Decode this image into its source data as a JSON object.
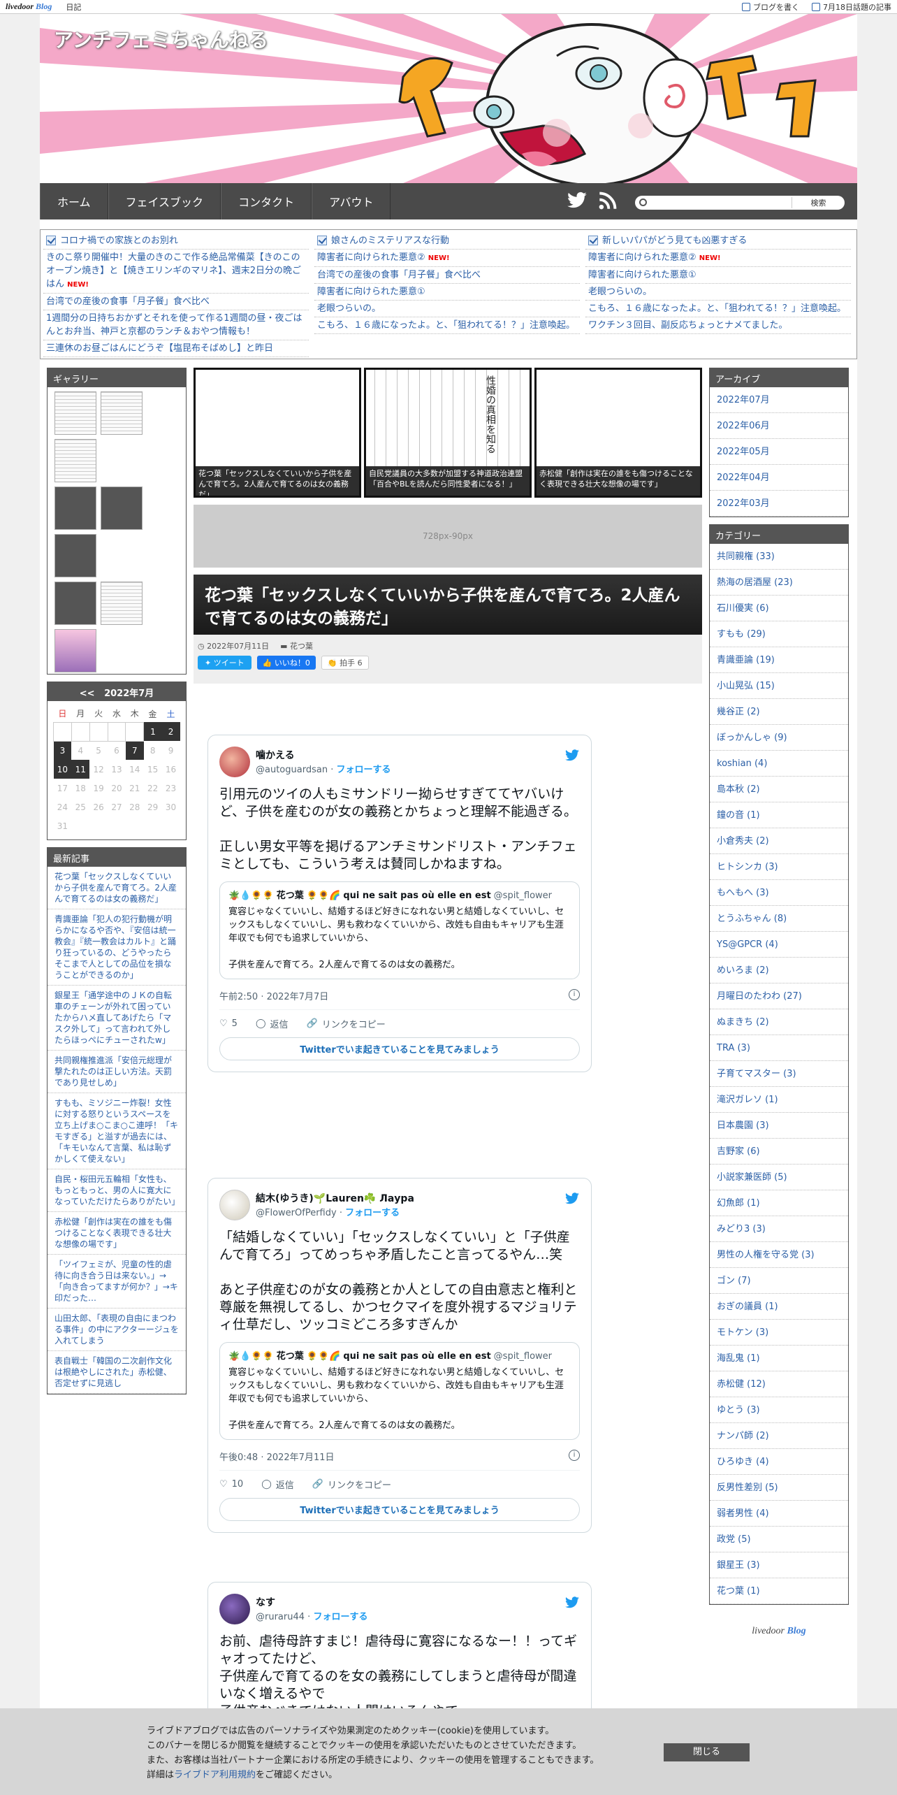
{
  "topbar": {
    "logo": "livedoor",
    "logo_blog": "Blog",
    "diary": "日記",
    "write": "ブログを書く",
    "topics": "7月18日話題の記事"
  },
  "header": {
    "site_title": "アンチフェミちゃんねる",
    "nav": [
      "ホーム",
      "フェイスブック",
      "コンタクト",
      "アバウト"
    ],
    "search_button": "検索",
    "search_placeholder": ""
  },
  "ticker": {
    "col1": [
      {
        "text": "コロナ禍での家族とのお別れ",
        "head": true
      },
      {
        "text": "きのこ祭り開催中！大量のきのこで作る絶品常備菜【きのこのオーブン焼き】と【焼きエリンギのマリネ】、週末2日分の晩ごはん",
        "new": "NEW!"
      },
      {
        "text": "台湾での産後の食事「月子餐」食べ比べ"
      },
      {
        "text": "1週間分の日持ちおかずとそれを使って作る1週間の昼・夜ごはんとお弁当、神戸と京都のランチ＆おやつ情報も！"
      },
      {
        "text": "三連休のお昼ごはんにどうぞ【塩昆布そばめし】と昨日"
      }
    ],
    "col2": [
      {
        "text": "娘さんのミステリアスな行動",
        "head": true
      },
      {
        "text": "障害者に向けられた悪意②",
        "new": "NEW!"
      },
      {
        "text": "台湾での産後の食事「月子餐」食べ比べ"
      },
      {
        "text": "障害者に向けられた悪意①"
      },
      {
        "text": "老眼つらいの。"
      },
      {
        "text": "こもろ、１６歳になったよ。と、「狙われてる！？」注意喚起。"
      }
    ],
    "col3": [
      {
        "text": "新しいパパがどう見ても凶悪すぎる",
        "head": true
      },
      {
        "text": "障害者に向けられた悪意②",
        "new": "NEW!"
      },
      {
        "text": "障害者に向けられた悪意①"
      },
      {
        "text": "老眼つらいの。"
      },
      {
        "text": "こもろ、１６歳になったよ。と、「狙われてる！？」注意喚起。"
      },
      {
        "text": "ワクチン３回目、副反応ちょっとナメてました。"
      }
    ]
  },
  "left": {
    "gallery_title": "ギャラリー",
    "calendar": {
      "prev": "<<",
      "month": "2022年7月",
      "weekdays": [
        "日",
        "月",
        "火",
        "水",
        "木",
        "金",
        "土"
      ],
      "rows": [
        [
          "",
          "",
          "",
          "",
          "",
          "1",
          "2"
        ],
        [
          "3",
          "4",
          "5",
          "6",
          "7",
          "8",
          "9"
        ],
        [
          "10",
          "11",
          "12",
          "13",
          "14",
          "15",
          "16"
        ],
        [
          "17",
          "18",
          "19",
          "20",
          "21",
          "22",
          "23"
        ],
        [
          "24",
          "25",
          "26",
          "27",
          "28",
          "29",
          "30"
        ],
        [
          "31",
          "",
          "",
          "",
          "",
          "",
          ""
        ]
      ]
    },
    "recent_title": "最新記事",
    "recent": [
      "花つ葉「セックスしなくていいから子供を産んで育てろ。2人産んで育てるのは女の義務だ」",
      "青識亜論「犯人の犯行動機が明らかになるや否や、『安倍は統一教会』『統一教会はカルト』と踊り狂っているの、どうやったらそこまで人としての品位を損なうことができるのか」",
      "銀星王「通学途中のＪＫの自転車のチェーンが外れて困っていたからハメ直してあげたら「マスク外して」って言われて外したらほっぺにチューされたw」",
      "共同親権推進派「安倍元総理が撃たれたのは正しい方法。天罰であり見せしめ」",
      "すもも、ミソジニー炸裂！女性に対する怒りというスペースを立ち上げま○こま○こ連呼！「キモすぎる」と溢すが過去には、「キモいなんて言葉、私は恥ずかしくて使えない」",
      "自民・桜田元五輪相「女性も、もっともっと、男の人に寛大になっていただけたらありがたい」",
      "赤松健「創作は実在の誰をも傷つけることなく表現できる壮大な想像の場です」",
      "「ツイフェミが、児童の性的虐待に向き合う日は来ない。」→「向き合ってますが何か？」→キ印だった…",
      "山田太郎、「表現の自由にまつわる事件」の中にアクターージュを入れてしまう",
      "表自戦士「韓国の二次創作文化は根絶やしにされた」赤松健、否定せずに見逃し"
    ]
  },
  "center": {
    "slides": [
      "花つ葉「セックスしなくていいから子供を産んで育てろ。2人産んで育てるのは女の義務だ」",
      "自民党議員の大多数が加盟する神道政治連盟「百合やBLを読んだら同性愛者になる！」",
      "赤松健「創作は実在の誰をも傷つけることなく表現できる壮大な想像の場です」"
    ],
    "slide2_heading": "性婚の真相を知る",
    "ad": "728px-90px",
    "title": "花つ葉「セックスしなくていいから子供を産んで育てろ。2人産んで育てるのは女の義務だ」",
    "date": "2022年07月11日",
    "category": "花つ葉",
    "tweet_btn": "ツイート",
    "like_btn": "いいね！0",
    "clap_btn": "拍手",
    "clap_count": "6",
    "tweets": [
      {
        "name": "噛かえる",
        "handle": "@autoguardsan",
        "follow": "フォローする",
        "body": "引用元のツイの人もミサンドリー拗らせすぎててヤバいけど、子供を産むのが女の義務とかちょっと理解不能過ぎる。\n\n正しい男女平等を掲げるアンチミサンドリスト・アンチフェミとしても、こういう考えは賛同しかねますね。",
        "quote_name": "花つ葉",
        "quote_suffix": "qui ne sait pas où elle en est",
        "quote_handle": "@spit_flower",
        "quote_body": "寛容じゃなくていいし、結婚するほど好きになれない男と結婚しなくていいし、セックスもしなくていいし、男も救わなくていいから、改姓も自由もキャリアも生涯年収でも何でも追求していいから、\n\n子供を産んで育てろ。2人産んで育てるのは女の義務だ。",
        "time": "午前2:50 · 2022年7月7日",
        "likes": "5",
        "reply": "返信",
        "copy": "リンクをコピー",
        "more": "Twitterでいま起きていることを見てみましょう"
      },
      {
        "name": "結木(ゆうき)🌱Lauren☘️ Лаура",
        "handle": "@FlowerOfPerfidy",
        "follow": "フォローする",
        "body": "「結婚しなくていい」「セックスしなくていい」と「子供産んで育てろ」ってめっちゃ矛盾したこと言ってるやん…笑\n\nあと子供産むのが女の義務とか人としての自由意志と権利と尊厳を無視してるし、かつセクマイを度外視するマジョリティ仕草だし、ツッコミどころ多すぎんか",
        "quote_name": "花つ葉",
        "quote_suffix": "qui ne sait pas où elle en est",
        "quote_handle": "@spit_flower",
        "quote_body": "寛容じゃなくていいし、結婚するほど好きになれない男と結婚しなくていいし、セックスもしなくていいし、男も救わなくていいから、改姓も自由もキャリアも生涯年収でも何でも追求していいから、\n\n子供を産んで育てろ。2人産んで育てるのは女の義務だ。",
        "time": "午後0:48 · 2022年7月11日",
        "likes": "10",
        "reply": "返信",
        "copy": "リンクをコピー",
        "more": "Twitterでいま起きていることを見てみましょう"
      },
      {
        "name": "なす",
        "handle": "@ruraru44",
        "follow": "フォローする",
        "body": "お前、虐待母許すまじ！虐待母に寛容になるなー！！ってギャオってたけど、\n子供産んで育てるのを女の義務にしてしまうと虐待母が間違いなく増えるやで\n子供産むべきではない人間はいるんやで"
      }
    ]
  },
  "right": {
    "archive_title": "アーカイブ",
    "archive": [
      "2022年07月",
      "2022年06月",
      "2022年05月",
      "2022年04月",
      "2022年03月"
    ],
    "category_title": "カテゴリー",
    "categories": [
      "共同親権 (33)",
      "熱海の居酒屋 (23)",
      "石川優実 (6)",
      "すもも (29)",
      "青識亜論 (19)",
      "小山晃弘 (15)",
      "幾谷正 (2)",
      "ぼっかんしゃ (9)",
      "koshian (4)",
      "島本秋 (2)",
      "鐘の音 (1)",
      "小倉秀夫 (2)",
      "ヒトシンカ (3)",
      "もへもへ (3)",
      "とうふちゃん (8)",
      "YS@GPCR (4)",
      "めいろま (2)",
      "月曜日のたわわ (27)",
      "ぬまきち (2)",
      "TRA (3)",
      "子育てマスター (3)",
      "滝沢ガレソ (1)",
      "日本農園 (3)",
      "吉野家 (6)",
      "小説家兼医師 (5)",
      "幻魚郎 (1)",
      "みどり3 (3)",
      "男性の人権を守る党 (3)",
      "ゴン (7)",
      "おぎの議員 (1)",
      "モトケン (3)",
      "海乱鬼 (1)",
      "赤松健 (12)",
      "ゆとう (3)",
      "ナンパ師 (2)",
      "ひろゆき (4)",
      "反男性差別 (5)",
      "弱者男性 (4)",
      "政党 (5)",
      "銀星王 (3)",
      "花つ葉 (1)"
    ],
    "footer_logo": "livedoor",
    "footer_logo_blog": "Blog"
  },
  "cookie": {
    "line1": "ライブドアブログでは広告のパーソナライズや効果測定のためクッキー(cookie)を使用しています。",
    "line2": "このバナーを閉じるか閲覧を継続することでクッキーの使用を承認いただいたものとさせていただきます。",
    "line3": "また、お客様は当社パートナー企業における所定の手続きにより、クッキーの使用を管理することもできます。",
    "line4_pre": "詳細は",
    "line4_link": "ライブドア利用規約",
    "line4_post": "をご確認ください。",
    "close": "閉じる"
  },
  "colors": {
    "nav_bg": "#4a4a4a",
    "link": "#2b5fa6",
    "twitter_blue": "#1d9bf0",
    "header_pink": "#f4a8c8",
    "header_orange": "#f5a623"
  }
}
